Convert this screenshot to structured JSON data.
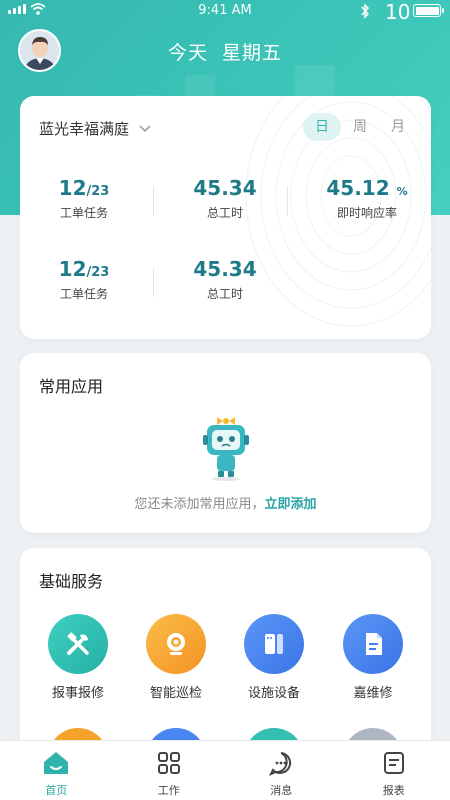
{
  "status_bar": {
    "time": "9:41 AM",
    "battery": "10"
  },
  "header": {
    "title": "今天  星期五"
  },
  "stats_card": {
    "project": "蓝光幸福满庭",
    "period_tabs": [
      "日",
      "周",
      "月"
    ],
    "active_period": "日",
    "row1": [
      {
        "value": "12",
        "suffix": "/23",
        "label": "工单任务"
      },
      {
        "value": "45.34",
        "suffix": "",
        "label": "总工时"
      },
      {
        "value": "45.12",
        "suffix": "%",
        "label": "即时响应率"
      }
    ],
    "row2": [
      {
        "value": "12",
        "suffix": "/23",
        "label": "工单任务"
      },
      {
        "value": "45.34",
        "suffix": "",
        "label": "总工时"
      }
    ]
  },
  "common_apps": {
    "title": "常用应用",
    "empty_text": "您还未添加常用应用，",
    "add_link": "立即添加"
  },
  "basic_services": {
    "title": "基础服务",
    "items": [
      {
        "label": "报事报修",
        "icon": "wrench-hammer-icon",
        "color": "#2fbfb3"
      },
      {
        "label": "智能巡检",
        "icon": "camera-icon",
        "color": "#f7a22c"
      },
      {
        "label": "设施设备",
        "icon": "device-icon",
        "color": "#3f7ff0"
      },
      {
        "label": "嘉维修",
        "icon": "document-icon",
        "color": "#3a7df0"
      }
    ]
  },
  "tabbar": {
    "items": [
      {
        "label": "首页",
        "icon": "home-icon"
      },
      {
        "label": "工作",
        "icon": "grid-icon"
      },
      {
        "label": "消息",
        "icon": "message-icon"
      },
      {
        "label": "报表",
        "icon": "report-icon"
      }
    ],
    "active": "首页",
    "accent": "#2aa5a4"
  }
}
